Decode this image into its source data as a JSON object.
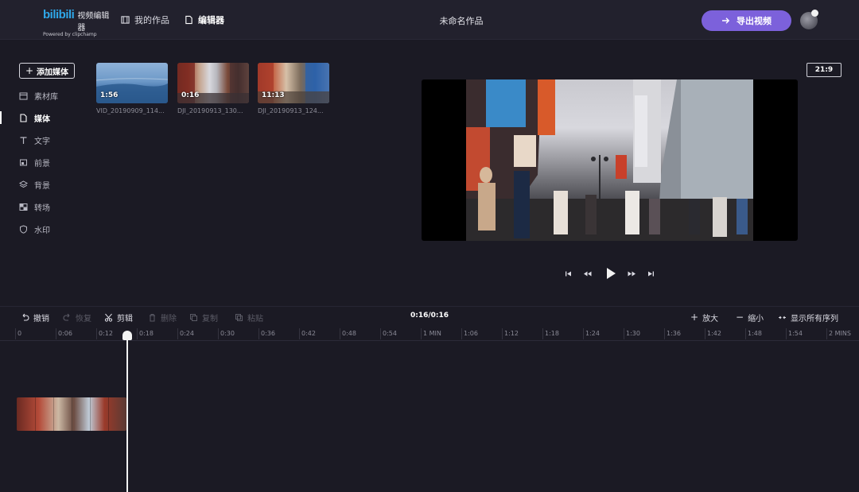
{
  "header": {
    "logo_brand": "bilibili",
    "logo_title": "视频编辑器",
    "logo_powered": "Powered by clipchamp",
    "nav": [
      {
        "label": "我的作品",
        "icon": "film-icon"
      },
      {
        "label": "编辑器",
        "icon": "document-icon"
      }
    ],
    "project_title": "未命名作品",
    "export_label": "导出视频"
  },
  "sidebar": {
    "add_media_label": "添加媒体",
    "items": [
      {
        "label": "素材库",
        "icon": "library-icon"
      },
      {
        "label": "媒体",
        "icon": "media-icon",
        "active": true
      },
      {
        "label": "文字",
        "icon": "text-icon"
      },
      {
        "label": "前景",
        "icon": "foreground-icon"
      },
      {
        "label": "背景",
        "icon": "layers-icon"
      },
      {
        "label": "转场",
        "icon": "transition-icon"
      },
      {
        "label": "水印",
        "icon": "shield-icon"
      }
    ]
  },
  "media": {
    "items": [
      {
        "duration": "1:56",
        "name": "VID_20190909_114..."
      },
      {
        "duration": "0:16",
        "name": "DJI_20190913_130..."
      },
      {
        "duration": "11:13",
        "name": "DJI_20190913_124..."
      }
    ]
  },
  "preview": {
    "aspect_ratio": "21:9"
  },
  "timeline": {
    "undo": "撤销",
    "redo": "恢复",
    "cut": "剪辑",
    "delete": "删除",
    "copy": "复制",
    "paste": "粘贴",
    "time": "0:16/0:16",
    "zoom_in": "放大",
    "zoom_out": "缩小",
    "show_all": "显示所有序列",
    "ticks": [
      "0",
      "0:06",
      "0:12",
      "0:18",
      "0:24",
      "0:30",
      "0:36",
      "0:42",
      "0:48",
      "0:54",
      "1 MIN",
      "1:06",
      "1:12",
      "1:18",
      "1:24",
      "1:30",
      "1:36",
      "1:42",
      "1:48",
      "1:54",
      "2 MINS"
    ]
  },
  "colors": {
    "accent": "#7c61db",
    "background": "#1b1a24",
    "header": "#22212d"
  }
}
